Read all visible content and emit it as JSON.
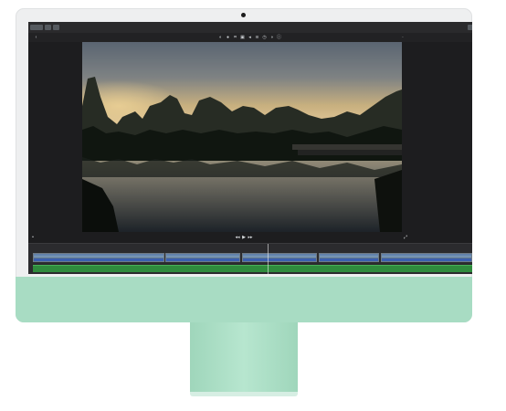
{
  "titlebar": {
    "window_title": "",
    "buttons": [
      "",
      "",
      ""
    ]
  },
  "toolbar": {
    "tools": [
      "color-balance",
      "color-correction",
      "crop",
      "stabilization",
      "volume",
      "noise-reduction",
      "speed",
      "filters",
      "info"
    ]
  },
  "playback": {
    "controls": [
      "rewind",
      "play",
      "fast-forward"
    ]
  },
  "timeline": {
    "clip_count": 5,
    "audio_track_label": ""
  },
  "colors": {
    "screen_bg": "#1d1d1f",
    "audio_track": "#2f8b3d",
    "clip_audio": "#3b5fb0",
    "imac_body": "#a8dcc3"
  }
}
